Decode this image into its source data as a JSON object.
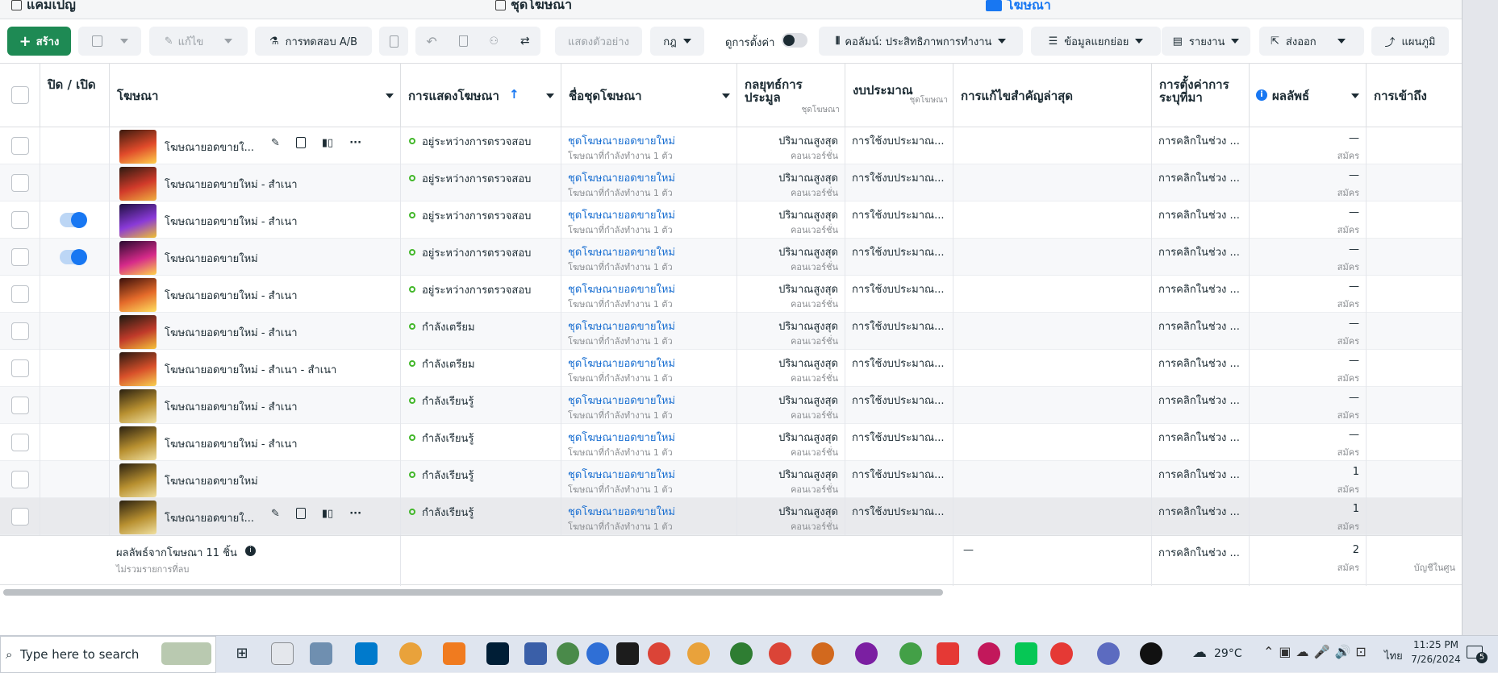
{
  "levels": {
    "campaigns": "แคมเปญ",
    "adsets": "ชุดโฆษณา",
    "ads": "โฆษณา"
  },
  "toolbar": {
    "create": "สร้าง",
    "edit": "แก้ไข",
    "ab_test": "การทดสอบ A/B",
    "preview": "แสดงตัวอย่าง",
    "rules": "กฎ",
    "view_setup": "ดูการตั้งค่า",
    "columns": "คอลัมน์: ประสิทธิภาพการทำงาน",
    "breakdown": "ข้อมูลแยกย่อย",
    "reports": "รายงาน",
    "export": "ส่งออก",
    "charts": "แผนภูมิ"
  },
  "headers": {
    "onoff": "ปิด / เปิด",
    "ad": "โฆษณา",
    "delivery": "การแสดงโฆษณา",
    "adset": "ชื่อชุดโฆษณา",
    "bid": "กลยุทธ์การประมูล",
    "bid_sub": "ชุดโฆษณา",
    "budget": "งบประมาณ",
    "budget_sub": "ชุดโฆษณา",
    "last_edit": "การแก้ไขสำคัญล่าสุด",
    "attribution": "การตั้งค่าการระบุที่มา",
    "results": "ผลลัพธ์",
    "reach": "การเข้าถึง"
  },
  "rows": [
    {
      "name": "โฆษณายอดขายใ...",
      "status": "อยู่ระหว่างการตรวจสอบ",
      "adset": "ชุดโฆษณายอดขายใหม่",
      "adset_sub": "โฆษณาที่กำลังทำงาน 1 ตัว",
      "bid": "ปริมาณสูงสุด",
      "bid_sub": "คอนเวอร์ชั่น",
      "budget": "การใช้งบประมาณ...",
      "attr": "การคลิกในช่วง ...",
      "result": "—",
      "result_sub": "สมัคร",
      "toggle": "none",
      "actions": true,
      "hl": false
    },
    {
      "name": "โฆษณายอดขายใหม่ - สำเนา",
      "status": "อยู่ระหว่างการตรวจสอบ",
      "adset": "ชุดโฆษณายอดขายใหม่",
      "adset_sub": "โฆษณาที่กำลังทำงาน 1 ตัว",
      "bid": "ปริมาณสูงสุด",
      "bid_sub": "คอนเวอร์ชั่น",
      "budget": "การใช้งบประมาณ...",
      "attr": "การคลิกในช่วง ...",
      "result": "—",
      "result_sub": "สมัคร",
      "toggle": "none",
      "actions": false,
      "hl": false
    },
    {
      "name": "โฆษณายอดขายใหม่ - สำเนา",
      "status": "อยู่ระหว่างการตรวจสอบ",
      "adset": "ชุดโฆษณายอดขายใหม่",
      "adset_sub": "โฆษณาที่กำลังทำงาน 1 ตัว",
      "bid": "ปริมาณสูงสุด",
      "bid_sub": "คอนเวอร์ชั่น",
      "budget": "การใช้งบประมาณ...",
      "attr": "การคลิกในช่วง ...",
      "result": "—",
      "result_sub": "สมัคร",
      "toggle": "on",
      "actions": false,
      "hl": false
    },
    {
      "name": "โฆษณายอดขายใหม่",
      "status": "อยู่ระหว่างการตรวจสอบ",
      "adset": "ชุดโฆษณายอดขายใหม่",
      "adset_sub": "โฆษณาที่กำลังทำงาน 1 ตัว",
      "bid": "ปริมาณสูงสุด",
      "bid_sub": "คอนเวอร์ชั่น",
      "budget": "การใช้งบประมาณ...",
      "attr": "การคลิกในช่วง ...",
      "result": "—",
      "result_sub": "สมัคร",
      "toggle": "on",
      "actions": false,
      "hl": false
    },
    {
      "name": "โฆษณายอดขายใหม่ - สำเนา",
      "status": "อยู่ระหว่างการตรวจสอบ",
      "adset": "ชุดโฆษณายอดขายใหม่",
      "adset_sub": "โฆษณาที่กำลังทำงาน 1 ตัว",
      "bid": "ปริมาณสูงสุด",
      "bid_sub": "คอนเวอร์ชั่น",
      "budget": "การใช้งบประมาณ...",
      "attr": "การคลิกในช่วง ...",
      "result": "—",
      "result_sub": "สมัคร",
      "toggle": "none",
      "actions": false,
      "hl": false
    },
    {
      "name": "โฆษณายอดขายใหม่ - สำเนา",
      "status": "กำลังเตรียม",
      "adset": "ชุดโฆษณายอดขายใหม่",
      "adset_sub": "โฆษณาที่กำลังทำงาน 1 ตัว",
      "bid": "ปริมาณสูงสุด",
      "bid_sub": "คอนเวอร์ชั่น",
      "budget": "การใช้งบประมาณ...",
      "attr": "การคลิกในช่วง ...",
      "result": "—",
      "result_sub": "สมัคร",
      "toggle": "none",
      "actions": false,
      "hl": false
    },
    {
      "name": "โฆษณายอดขายใหม่ - สำเนา - สำเนา",
      "status": "กำลังเตรียม",
      "adset": "ชุดโฆษณายอดขายใหม่",
      "adset_sub": "โฆษณาที่กำลังทำงาน 1 ตัว",
      "bid": "ปริมาณสูงสุด",
      "bid_sub": "คอนเวอร์ชั่น",
      "budget": "การใช้งบประมาณ...",
      "attr": "การคลิกในช่วง ...",
      "result": "—",
      "result_sub": "สมัคร",
      "toggle": "none",
      "actions": false,
      "hl": false
    },
    {
      "name": "โฆษณายอดขายใหม่ - สำเนา",
      "status": "กำลังเรียนรู้",
      "adset": "ชุดโฆษณายอดขายใหม่",
      "adset_sub": "โฆษณาที่กำลังทำงาน 1 ตัว",
      "bid": "ปริมาณสูงสุด",
      "bid_sub": "คอนเวอร์ชั่น",
      "budget": "การใช้งบประมาณ...",
      "attr": "การคลิกในช่วง ...",
      "result": "—",
      "result_sub": "สมัคร",
      "toggle": "none",
      "actions": false,
      "hl": false
    },
    {
      "name": "โฆษณายอดขายใหม่ - สำเนา",
      "status": "กำลังเรียนรู้",
      "adset": "ชุดโฆษณายอดขายใหม่",
      "adset_sub": "โฆษณาที่กำลังทำงาน 1 ตัว",
      "bid": "ปริมาณสูงสุด",
      "bid_sub": "คอนเวอร์ชั่น",
      "budget": "การใช้งบประมาณ...",
      "attr": "การคลิกในช่วง ...",
      "result": "—",
      "result_sub": "สมัคร",
      "toggle": "none",
      "actions": false,
      "hl": false
    },
    {
      "name": "โฆษณายอดขายใหม่",
      "status": "กำลังเรียนรู้",
      "adset": "ชุดโฆษณายอดขายใหม่",
      "adset_sub": "โฆษณาที่กำลังทำงาน 1 ตัว",
      "bid": "ปริมาณสูงสุด",
      "bid_sub": "คอนเวอร์ชั่น",
      "budget": "การใช้งบประมาณ...",
      "attr": "การคลิกในช่วง ...",
      "result": "1",
      "result_sub": "สมัคร",
      "toggle": "none",
      "actions": false,
      "hl": false
    },
    {
      "name": "โฆษณายอดขายใ...",
      "status": "กำลังเรียนรู้",
      "adset": "ชุดโฆษณายอดขายใหม่",
      "adset_sub": "โฆษณาที่กำลังทำงาน 1 ตัว",
      "bid": "ปริมาณสูงสุด",
      "bid_sub": "คอนเวอร์ชั่น",
      "budget": "การใช้งบประมาณ...",
      "attr": "การคลิกในช่วง ...",
      "result": "1",
      "result_sub": "สมัคร",
      "toggle": "none",
      "actions": true,
      "hl": true
    }
  ],
  "summary": {
    "label": "ผลลัพธ์จากโฆษณา 11 ชิ้น",
    "sub": "ไม่รวมรายการที่ลบ",
    "last_edit": "—",
    "attr": "การคลิกในช่วง ...",
    "result": "2",
    "result_sub": "สมัคร",
    "reach": "บัญชีในศูน"
  },
  "taskbar": {
    "search_placeholder": "Type here to search",
    "weather": "29°C",
    "lang": "ไทย",
    "time": "11:25 PM",
    "date": "7/26/2024",
    "notif_count": "5"
  },
  "colors": {
    "primary_green": "#1e8a54",
    "accent_blue": "#1877f2",
    "status_green": "#42b72a"
  },
  "icons": [
    "plus-icon",
    "copy-icon",
    "pencil-icon",
    "flask-icon",
    "clipboard-icon",
    "undo-icon",
    "trash-icon",
    "people-icon",
    "compare-icon",
    "columns-icon",
    "breakdown-icon",
    "report-icon",
    "export-icon",
    "chart-icon",
    "info-icon",
    "bar-chart-icon",
    "more-icon"
  ]
}
